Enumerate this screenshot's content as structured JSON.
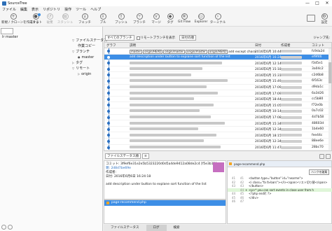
{
  "window": {
    "title": "SourceTree",
    "controls": [
      "—",
      "□",
      "✕"
    ]
  },
  "menu": [
    "ファイル",
    "編集",
    "表示",
    "リポジトリ",
    "操作",
    "ツール",
    "ヘルプ"
  ],
  "toolbar": {
    "buttons": [
      {
        "label": "新規 / クローンを作成する",
        "icon": "plus-icon"
      },
      {
        "label": "コミット",
        "icon": "commit-icon"
      },
      {
        "label": "破棄",
        "icon": "discard-icon"
      },
      {
        "label": "スタッシュ",
        "icon": "stash-icon"
      },
      {
        "label": "フェッチ",
        "icon": "fetch-icon"
      },
      {
        "label": "プル",
        "icon": "pull-icon"
      },
      {
        "label": "プッシュ",
        "icon": "push-icon"
      },
      {
        "label": "ブランチ",
        "icon": "branch-icon"
      },
      {
        "label": "マージ",
        "icon": "merge-icon"
      },
      {
        "label": "タグ",
        "icon": "tag-icon"
      },
      {
        "label": "Git Flow",
        "icon": "gitflow-icon"
      },
      {
        "label": "Explorer",
        "icon": "folder-icon"
      },
      {
        "label": "ターミナル",
        "icon": "terminal-icon"
      }
    ],
    "settings_label": "設定"
  },
  "left": {
    "branch_combo": "",
    "title": "lr master",
    "tree": {
      "file_status": "ファイルステータス",
      "working_copy": "作業コピー",
      "branches": "ブランチ",
      "master": "master",
      "tags": "タグ",
      "remotes": "リモート",
      "origin": "origin"
    }
  },
  "filter": {
    "branches": "すべてのブランチ",
    "show_remote": "リモートブランチを表示",
    "date_order": "日付の順",
    "jump": "ジャンプ先:"
  },
  "graph": {
    "headers": {
      "graph": "グラフ",
      "desc": "説明",
      "date": "日付",
      "author": "作成者",
      "commit": "コミット"
    },
    "rows": [
      {
        "tags": [
          "master",
          "origin/HEAD",
          "origin/master",
          "origin/master",
          "origin/HEAD"
        ],
        "desc": "add except character length",
        "date": "2016年6月 10:44",
        "hash": "fc9da2d",
        "selected": false
      },
      {
        "tags": [],
        "desc": "add description under button to explane sort function of the list",
        "date": "2016年6月 16:24",
        "hash": "ef9f46",
        "selected": true
      },
      {
        "tags": [],
        "desc": "",
        "date": "2016年6月 12:14",
        "hash": "f3d5e1",
        "selected": false
      },
      {
        "tags": [],
        "desc": "",
        "date": "2016年6月 15:18",
        "hash": "3a04c2",
        "selected": false
      },
      {
        "tags": [],
        "desc": "",
        "date": "2016年6月 15:31",
        "hash": "c2d6b8",
        "selected": false
      },
      {
        "tags": [],
        "desc": "",
        "date": "2016年6月 15:49",
        "hash": "6f163c",
        "selected": false
      },
      {
        "tags": [],
        "desc": "",
        "date": "2016年6月 17:09",
        "hash": "d9da1c",
        "selected": false
      },
      {
        "tags": [],
        "desc": "",
        "date": "2016年6月 17:09",
        "hash": "6a3d26",
        "selected": false
      },
      {
        "tags": [],
        "desc": "",
        "date": "2016年6月 18:44",
        "hash": "cc5b80",
        "selected": false
      },
      {
        "tags": [],
        "desc": "",
        "date": "2016年6月 15:05",
        "hash": "f72e0b",
        "selected": false
      },
      {
        "tags": [],
        "desc": "",
        "date": "2016年6月 10:14",
        "hash": "0a7c02",
        "selected": false
      },
      {
        "tags": [],
        "desc": "",
        "date": "2016年6月 17:08",
        "hash": "4d7b58",
        "selected": false
      },
      {
        "tags": [],
        "desc": "",
        "date": "2016年6月 15:34",
        "hash": "48603d",
        "selected": false
      },
      {
        "tags": [],
        "desc": "",
        "date": "2016年6月 12:34",
        "hash": "1b4e60",
        "selected": false
      },
      {
        "tags": [],
        "desc": "",
        "date": "2016年6月 18:15",
        "hash": "fee44c",
        "selected": false
      },
      {
        "tags": [],
        "desc": "",
        "date": "2016年6月 12:34",
        "hash": "88ee6e",
        "selected": false
      },
      {
        "tags": [],
        "desc": "",
        "date": "2016年6月 11:47",
        "hash": "28bc70",
        "selected": false
      },
      {
        "tags": [],
        "desc": "",
        "date": "2016年6月 11:25",
        "hash": "e4e9d2",
        "selected": false
      }
    ]
  },
  "details": {
    "sort": "ファイルステータス順",
    "view": "≡",
    "commit_line": "コミット: 3f9ef6e31e2e5b5323220d0d5a4de9412a08de2c4 [f5e3b11]",
    "parent_line": "親: 2d8d7be69e",
    "author_line": "作成者:",
    "date_line": "日付: 2016年6月6日 16:24:18",
    "message": "add description under button to explane sort function of the list",
    "file": "page-recommend.php"
  },
  "diff": {
    "file": "page-recommend.php",
    "hunk_button": "ハンクを破棄",
    "lines": [
      {
        "n1": "41",
        "n2": "41",
        "pm": "",
        "text": "<button type=\"button\" id=\"nearme\">",
        "type": "ctx"
      },
      {
        "n1": "42",
        "n2": "42",
        "pm": "",
        "text": "    <i class=\"fa fa-bars\"></i><span>リスト切り替</span>",
        "type": "ctx"
      },
      {
        "n1": "43",
        "n2": "43",
        "pm": "",
        "text": "</button>",
        "type": "ctx"
      },
      {
        "n1": "",
        "n2": "44",
        "pm": "+",
        "text": "<p>* you can sort events in close user from h",
        "type": "add"
      },
      {
        "n1": "44",
        "n2": "45",
        "pm": "",
        "text": "<?php endif; ?>",
        "type": "ctx"
      },
      {
        "n1": "45",
        "n2": "46",
        "pm": "",
        "text": "</div>",
        "type": "ctx"
      },
      {
        "n1": "46",
        "n2": "47",
        "pm": "",
        "text": "",
        "type": "ctx"
      }
    ]
  },
  "tabs": [
    "ファイルステータス",
    "ログ",
    "検索"
  ]
}
